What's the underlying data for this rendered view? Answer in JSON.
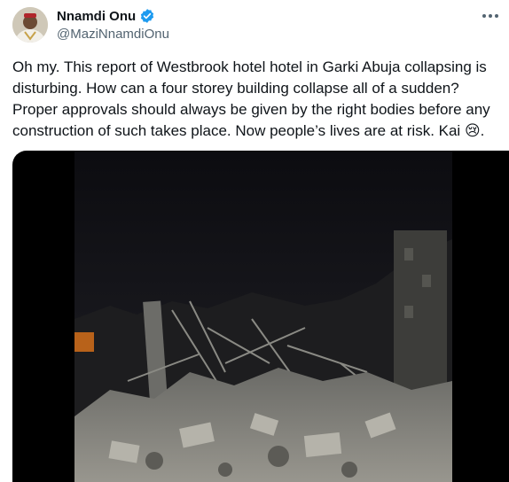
{
  "author": {
    "display_name": "Nnamdi Onu",
    "handle": "@MaziNnamdiOnu",
    "verified": true,
    "verified_color": "#1d9bf0"
  },
  "tweet": {
    "text": "Oh my. This report of Westbrook hotel hotel in Garki Abuja collapsing is disturbing. How can a four storey building collapse all of a sudden? Proper approvals should always be given by the right bodies before any construction of such takes place. Now people’s lives are at risk. Kai ",
    "emoji": "😢",
    "trailing": "."
  },
  "media": {
    "kind": "video",
    "subject": "collapsed building rubble at night"
  },
  "icons": {
    "more": "more-options-icon",
    "verified": "verified-badge-icon"
  }
}
